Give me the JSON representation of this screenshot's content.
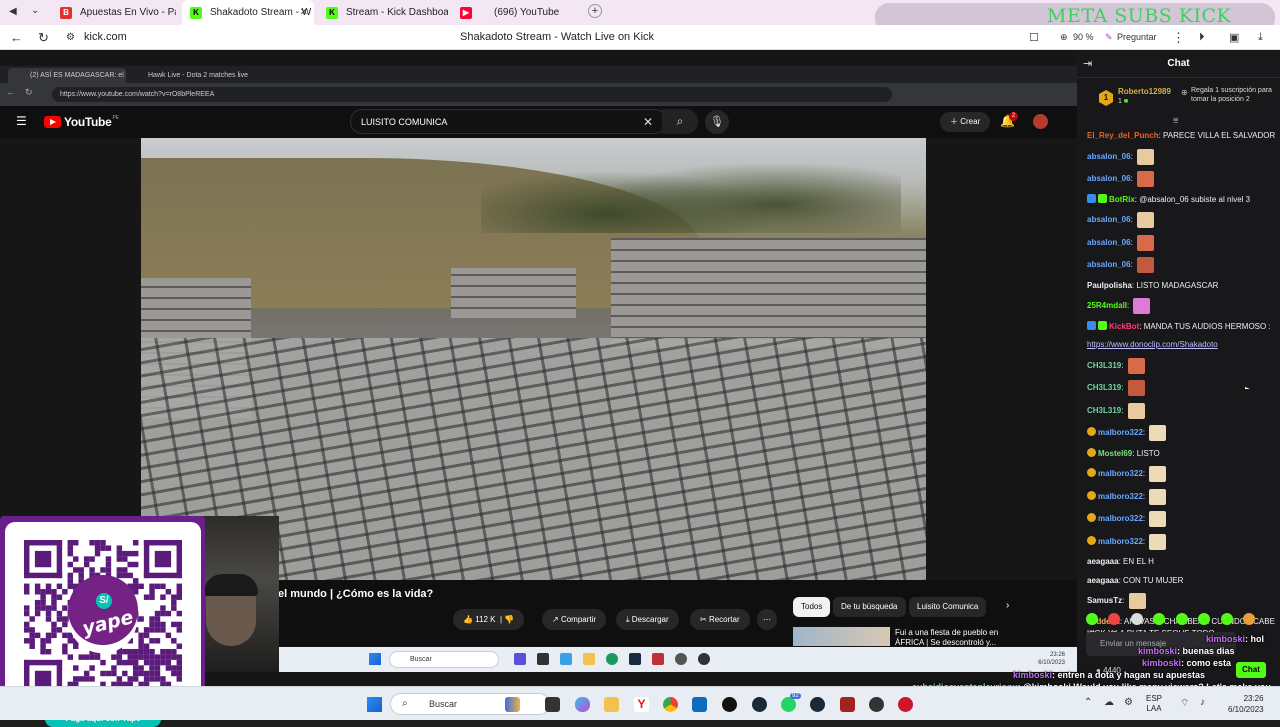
{
  "browser": {
    "tabs": [
      {
        "label": "Apuestas En Vivo - Partidos",
        "favicon": "betting-favicon",
        "color": "#e0312a"
      },
      {
        "label": "Shakadoto Stream - W",
        "favicon": "kick-favicon",
        "color": "#53fc18",
        "active": true
      },
      {
        "label": "Stream - Kick Dashboard",
        "favicon": "kick-favicon",
        "color": "#53fc18"
      },
      {
        "label": "(696) YouTube",
        "favicon": "youtube-favicon",
        "color": "#ff0033"
      }
    ],
    "url": "kick.com",
    "page_title": "Shakadoto Stream - Watch Live on Kick",
    "zoom": "90 %",
    "ask_label": "Preguntar",
    "overlay_goal": "META SUBS KICK 0/10"
  },
  "inner_browser": {
    "tabs": [
      "(2) ASÍ ES MADAGASCAR: el",
      "Hawk Live - Dota 2 matches live"
    ],
    "url": "https://www.youtube.com/watch?v=rO8bPleREEA"
  },
  "youtube": {
    "logo": "YouTube",
    "region": "PE",
    "search_query": "LUISITO COMUNICA",
    "create_label": "Crear",
    "notifications": "2",
    "video_title": "el mundo | ¿Cómo es la vida?",
    "likes": "112 K",
    "share_label": "Compartir",
    "download_label": "Descargar",
    "clip_label": "Recortar",
    "chips": [
      "Todos",
      "De tu búsqueda",
      "Luisito Comunica"
    ],
    "rec_title": "Fui a una fiesta de pueblo en ÁFRICA | Se descontroló y..."
  },
  "inner_taskbar": {
    "search": "Buscar",
    "time": "23:26",
    "date": "6/10/2023"
  },
  "qr": {
    "brand": "yape",
    "footer": "Paga aquí con Yape"
  },
  "taskbar": {
    "search": "Buscar",
    "lang1": "ESP",
    "lang2": "LAA",
    "time": "23:26",
    "date": "6/10/2023",
    "badge": "92"
  },
  "chat": {
    "title": "Chat",
    "pinned": {
      "user": "Roberto12989",
      "count": "1",
      "rank": "1",
      "note": "Regala 1 suscripción para tomar la posición 2"
    },
    "messages": [
      {
        "user": "El_Rey_del_Punch",
        "color": "#e0672f",
        "text": "PARECE VILLA EL SALVADOR"
      },
      {
        "user": "absalon_06",
        "color": "#6aa7ff",
        "text": "",
        "emote": true
      },
      {
        "user": "absalon_06",
        "color": "#6aa7ff",
        "text": "",
        "emote": true
      },
      {
        "user": "BotRix",
        "color": "#53fc18",
        "text": "@absalon_06 subiste al nivel 3",
        "badges": true
      },
      {
        "user": "absalon_06",
        "color": "#6aa7ff",
        "text": "",
        "emote": true
      },
      {
        "user": "absalon_06",
        "color": "#6aa7ff",
        "text": "",
        "emote": true
      },
      {
        "user": "absalon_06",
        "color": "#6aa7ff",
        "text": "",
        "emote": true
      },
      {
        "user": "Paulpolisha",
        "color": "#efeff1",
        "text": "LISTO MADAGASCAR"
      },
      {
        "user": "25R4mdall",
        "color": "#53fc18",
        "text": "",
        "emote": true
      },
      {
        "user": "KickBot",
        "color": "#ff3b7a",
        "text": "MANDA TUS AUDIOS HERMOSO :",
        "badges": true
      },
      {
        "user": "",
        "color": "#efeff1",
        "text": "https://www.donoclip.com/Shakadoto",
        "link": true
      },
      {
        "user": "CH3L319",
        "color": "#6ad5a0",
        "text": "",
        "emote": true
      },
      {
        "user": "CH3L319",
        "color": "#6ad5a0",
        "text": "",
        "emote": true
      },
      {
        "user": "CH3L319",
        "color": "#6ad5a0",
        "text": "",
        "emote": true
      },
      {
        "user": "malboro322",
        "color": "#6aa7ff",
        "text": "",
        "emote": true,
        "sub": true
      },
      {
        "user": "Mostel69",
        "color": "#7ae07a",
        "text": "LISTO",
        "sub": true
      },
      {
        "user": "malboro322",
        "color": "#6aa7ff",
        "text": "",
        "emote": true,
        "sub": true
      },
      {
        "user": "malboro322",
        "color": "#6aa7ff",
        "text": "",
        "emote": true,
        "sub": true
      },
      {
        "user": "malboro322",
        "color": "#6aa7ff",
        "text": "",
        "emote": true,
        "sub": true
      },
      {
        "user": "malboro322",
        "color": "#6aa7ff",
        "text": "",
        "emote": true,
        "sub": true
      },
      {
        "user": "aeagaaa",
        "color": "#efeff1",
        "text": "EN EL H"
      },
      {
        "user": "aeagaaa",
        "color": "#efeff1",
        "text": "CON TU MUJER"
      },
      {
        "user": "SamusTz",
        "color": "#efeff1",
        "text": "",
        "emote": true
      },
      {
        "user": "dsddead",
        "color": "#f2b45b",
        "text": "AHI VAS A CHAMBEAR CUANDO ACABE KICK Y LA PUTA TE SEQUE TODO"
      }
    ],
    "input_placeholder": "Enviar un mensaje",
    "send_label": "Chat",
    "points": "4440"
  },
  "overlay_chat": [
    {
      "user": "kimboski",
      "text": "hol"
    },
    {
      "user": "kimboski",
      "text": "buenas dias"
    },
    {
      "user": "kimboski",
      "text": "como esta"
    },
    {
      "user": "kimboski",
      "text": "entren a dota y hagan su apuestas"
    },
    {
      "user": "subsidiosyentaplayrionx",
      "text": "@kimboski Would you like many viewers? Let's make you"
    }
  ]
}
